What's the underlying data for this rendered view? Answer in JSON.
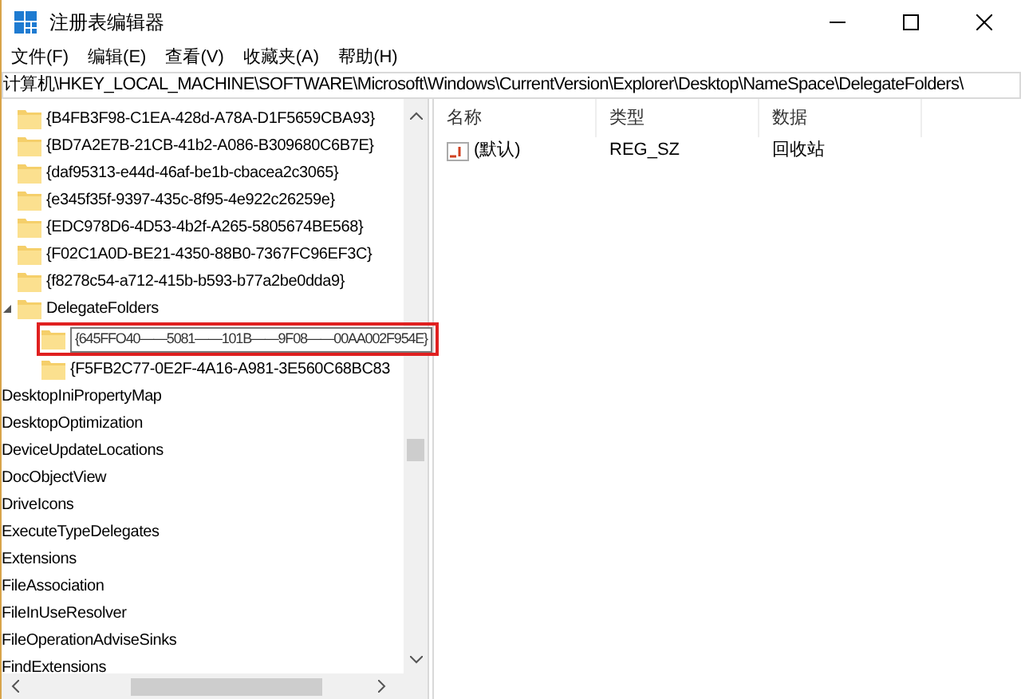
{
  "window": {
    "title": "注册表编辑器"
  },
  "menu": [
    "文件(F)",
    "编辑(E)",
    "查看(V)",
    "收藏夹(A)",
    "帮助(H)"
  ],
  "address": "计算机\\HKEY_LOCAL_MACHINE\\SOFTWARE\\Microsoft\\Windows\\CurrentVersion\\Explorer\\Desktop\\NameSpace\\DelegateFolders\\",
  "tree": [
    {
      "kind": "group",
      "children": [
        {
          "kind": "key",
          "label": "{B4FB3F98-C1EA-428d-A78A-D1F5659CBA93}"
        },
        {
          "kind": "key",
          "label": "{BD7A2E7B-21CB-41b2-A086-B309680C6B7E}"
        },
        {
          "kind": "key",
          "label": "{daf95313-e44d-46af-be1b-cbacea2c3065}"
        },
        {
          "kind": "key",
          "label": "{e345f35f-9397-435c-8f95-4e922c26259e}"
        },
        {
          "kind": "key",
          "label": "{EDC978D6-4D53-4b2f-A265-5805674BE568}"
        },
        {
          "kind": "key",
          "label": "{F02C1A0D-BE21-4350-88B0-7367FC96EF3C}"
        },
        {
          "kind": "key",
          "label": "{f8278c54-a712-415b-b593-b77a2be0dda9}"
        },
        {
          "kind": "key",
          "label": "DelegateFolders",
          "expanded": true,
          "children": [
            {
              "kind": "rename",
              "label": "{645FFO40——5081——101B——9F08——00AA002F954E}"
            },
            {
              "kind": "key",
              "label": "{F5FB2C77-0E2F-4A16-A981-3E560C68BC83"
            }
          ]
        }
      ]
    },
    {
      "kind": "key",
      "label": "DesktopIniPropertyMap"
    },
    {
      "kind": "key",
      "label": "DesktopOptimization"
    },
    {
      "kind": "key",
      "label": "DeviceUpdateLocations"
    },
    {
      "kind": "key",
      "label": "DocObjectView"
    },
    {
      "kind": "key",
      "label": "DriveIcons"
    },
    {
      "kind": "key",
      "label": "ExecuteTypeDelegates"
    },
    {
      "kind": "key",
      "label": "Extensions"
    },
    {
      "kind": "key",
      "label": "FileAssociation"
    },
    {
      "kind": "key",
      "label": "FileInUseResolver"
    },
    {
      "kind": "key",
      "label": "FileOperationAdviseSinks"
    },
    {
      "kind": "key",
      "label": "FindExtensions"
    }
  ],
  "values": {
    "columns": [
      "名称",
      "类型",
      "数据"
    ],
    "rows": [
      {
        "name": "(默认)",
        "type": "REG_SZ",
        "data": "回收站"
      }
    ]
  }
}
